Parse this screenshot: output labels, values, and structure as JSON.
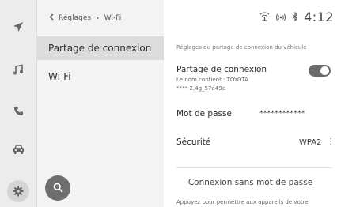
{
  "rail": {
    "items": [
      {
        "icon": "navigation-arrow-icon"
      },
      {
        "icon": "music-note-icon"
      },
      {
        "icon": "phone-icon"
      },
      {
        "icon": "car-icon"
      },
      {
        "icon": "gear-icon",
        "active": true
      }
    ]
  },
  "breadcrumb": {
    "back_label": "Réglages",
    "separator": "•",
    "current": "Wi-Fi"
  },
  "menu": {
    "items": [
      {
        "label": "Partage de connexion",
        "selected": true
      },
      {
        "label": "Wi-Fi",
        "selected": false
      }
    ]
  },
  "search": {
    "icon": "search-icon"
  },
  "status_bar": {
    "icons": [
      "signal-icon",
      "hotspot-icon",
      "bluetooth-icon"
    ],
    "time": "4:12"
  },
  "detail": {
    "section_caption": "Réglages du partage de connexion du véhicule",
    "sharing": {
      "title": "Partage de connexion",
      "line1": "Le nom contient : TOYOTA",
      "line2": "****-2.4g_57a49e",
      "toggle_on": true
    },
    "password": {
      "label": "Mot de passe",
      "value": "************"
    },
    "security": {
      "label": "Sécurité",
      "value": "WPA2"
    },
    "passwordless": {
      "title": "Connexion sans mot de passe",
      "description": "Appuyez pour permettre aux appareils de votre"
    }
  },
  "colors": {
    "rail_bg": "#ececec",
    "menu_bg": "#f3f3f3",
    "selected_bg": "#dcdcdc",
    "toggle_on": "#6b6b6b",
    "fab": "#6e6e6e"
  }
}
